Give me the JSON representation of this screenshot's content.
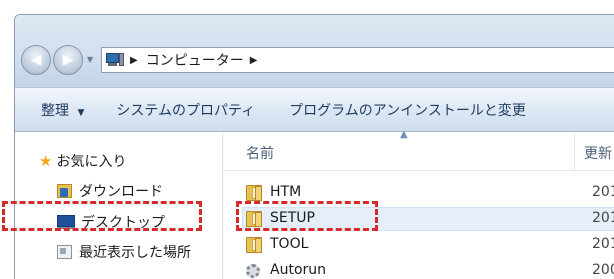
{
  "address_bar": {
    "back_glyph": "◀",
    "forward_glyph": "▶",
    "dropdown_glyph": "▼",
    "location_icon": "computer-icon",
    "separator_glyph": "▶",
    "crumb": "コンピューター",
    "trailing_separator_glyph": "▶"
  },
  "toolbar": {
    "organize_label": "整理",
    "organize_arrow": "▼",
    "system_properties_label": "システムのプロパティ",
    "uninstall_label": "プログラムのアンインストールと変更"
  },
  "nav_pane": {
    "items": [
      {
        "label": "お気に入り",
        "icon": "star-icon"
      },
      {
        "label": "ダウンロード",
        "icon": "download-folder-icon"
      },
      {
        "label": "デスクトップ",
        "icon": "desktop-icon"
      },
      {
        "label": "最近表示した場所",
        "icon": "recent-places-icon"
      }
    ]
  },
  "file_list": {
    "columns": {
      "name": "名前",
      "date": "更新",
      "sort_glyph": "▲"
    },
    "rows": [
      {
        "name": "HTM",
        "date": "201",
        "icon": "folder-icon",
        "selected": false
      },
      {
        "name": "SETUP",
        "date": "201",
        "icon": "folder-icon",
        "selected": true
      },
      {
        "name": "TOOL",
        "date": "201",
        "icon": "folder-icon",
        "selected": false
      },
      {
        "name": "Autorun",
        "date": "200",
        "icon": "settings-file-icon",
        "selected": false
      }
    ]
  },
  "colors": {
    "highlight_dash": "#d42a2a",
    "selection_bg": "#e6eef9",
    "toolbar_text": "#1e3a5f"
  }
}
